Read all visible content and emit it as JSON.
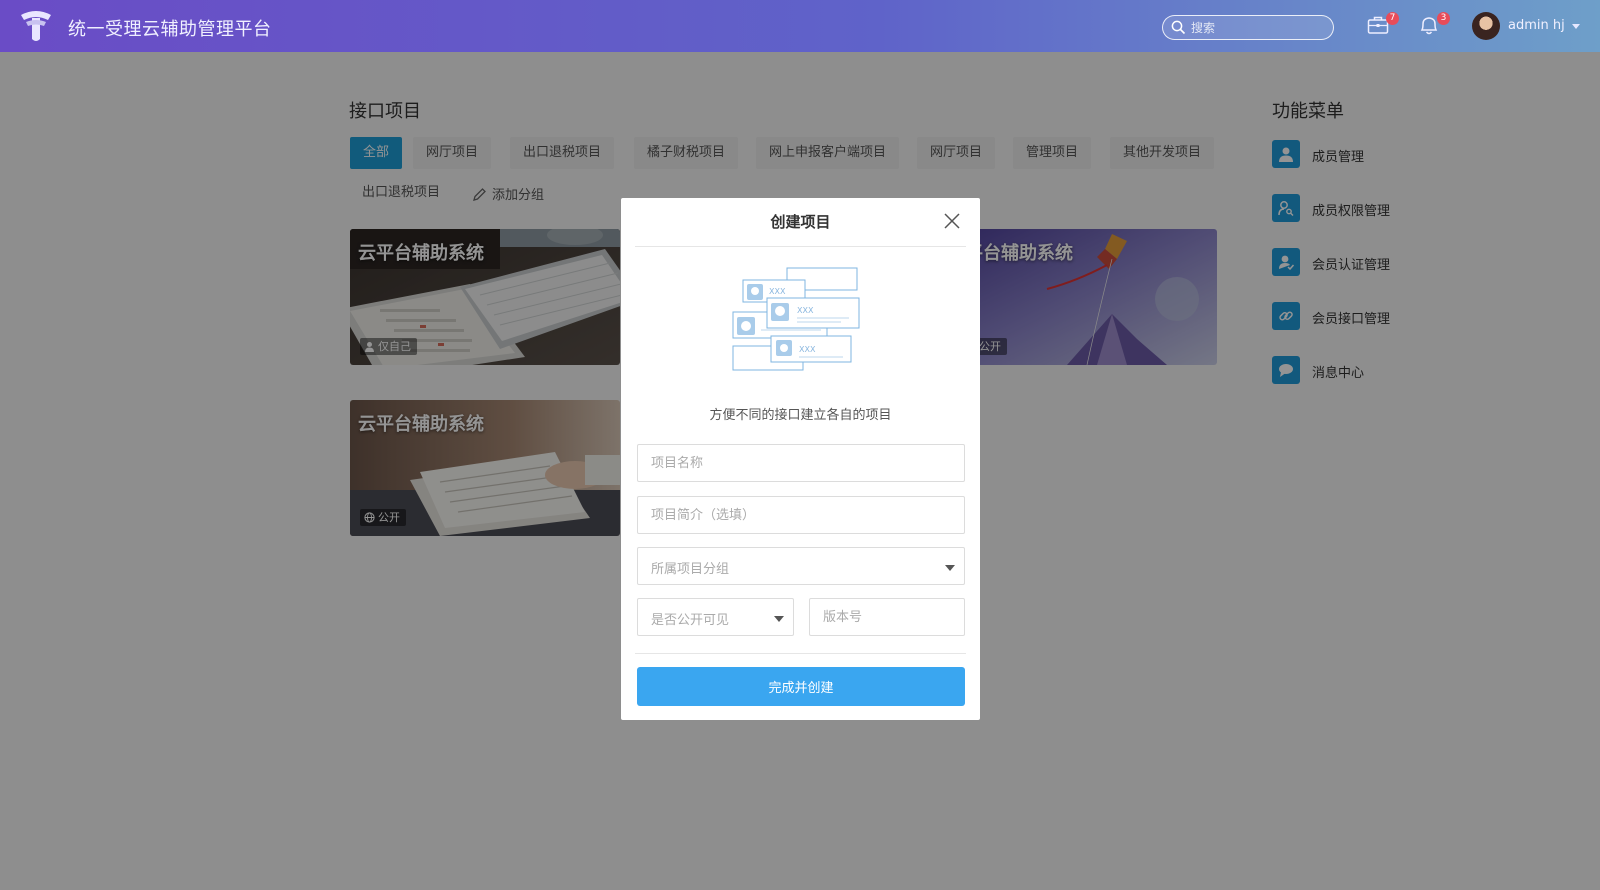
{
  "header": {
    "app_title": "统一受理云辅助管理平台",
    "search_placeholder": "搜索",
    "briefcase_badge": "7",
    "bell_badge": "3",
    "user_name": "admin hj"
  },
  "main": {
    "section_title": "接口项目",
    "tabs": [
      {
        "label": "全部",
        "active": true
      },
      {
        "label": "网厅项目"
      },
      {
        "label": "出口退税项目"
      },
      {
        "label": "橘子财税项目"
      },
      {
        "label": "网上申报客户端项目"
      },
      {
        "label": "网厅项目"
      },
      {
        "label": "管理项目"
      },
      {
        "label": "其他开发项目"
      },
      {
        "label": "出口退税项目"
      }
    ],
    "add_group_label": "添加分组",
    "cards": [
      {
        "title": "云平台辅助系统",
        "tag": "仅自己"
      },
      {
        "title": "平台辅助系统",
        "tag": "公开"
      },
      {
        "title": "云平台辅助系统",
        "tag": "公开"
      }
    ]
  },
  "side_menu": {
    "title": "功能菜单",
    "items": [
      {
        "label": "成员管理",
        "icon": "user-icon"
      },
      {
        "label": "成员权限管理",
        "icon": "user-key-icon"
      },
      {
        "label": "会员认证管理",
        "icon": "user-check-icon"
      },
      {
        "label": "会员接口管理",
        "icon": "link-icon"
      },
      {
        "label": "消息中心",
        "icon": "chat-icon"
      }
    ]
  },
  "modal": {
    "title": "创建项目",
    "description": "方便不同的接口建立各自的项目",
    "illustration_labels": [
      "XXX",
      "XXX",
      "XXX"
    ],
    "name_placeholder": "项目名称",
    "intro_placeholder": "项目简介（选填）",
    "group_placeholder": "所属项目分组",
    "visibility_placeholder": "是否公开可见",
    "version_placeholder": "版本号",
    "submit_label": "完成并创建"
  },
  "colors": {
    "accent": "#1e9ed6",
    "primary_button": "#3aa6f0",
    "badge": "#e84c5a"
  }
}
